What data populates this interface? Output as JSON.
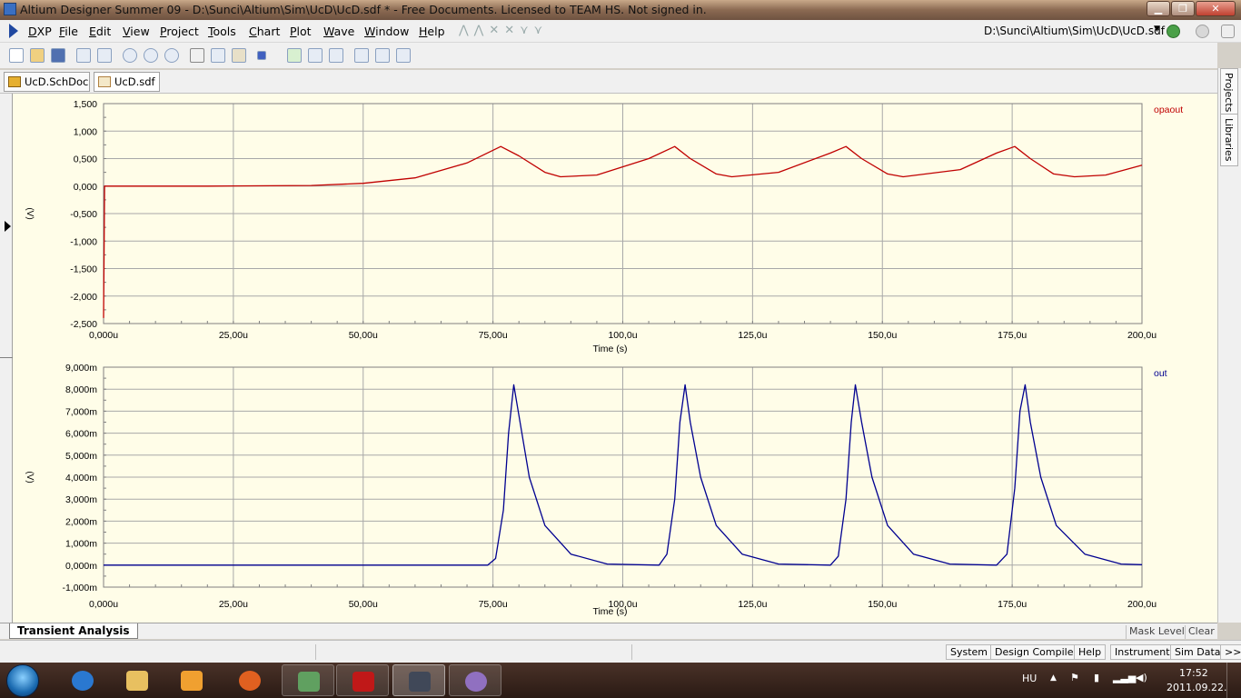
{
  "window": {
    "title": "Altium Designer Summer 09 - D:\\Sunci\\Altium\\Sim\\UcD\\UcD.sdf * - Free Documents. Licensed to TEAM HS. Not signed in."
  },
  "menu": {
    "items": [
      "DXP",
      "File",
      "Edit",
      "View",
      "Project",
      "Tools",
      "Chart",
      "Plot",
      "Wave",
      "Window",
      "Help"
    ],
    "path": "D:\\Sunci\\Altium\\Sim\\UcD\\UcD.sdf"
  },
  "tabs": {
    "documents": [
      "UcD.SchDoc *",
      "UcD.sdf *"
    ]
  },
  "right_panel": {
    "tabs": [
      "Projects",
      "Libraries"
    ]
  },
  "chart_data": [
    {
      "type": "line",
      "series": [
        {
          "name": "opaout",
          "color": "#c00000"
        }
      ],
      "ylabel": "(V)",
      "xlabel": "Time (s)",
      "ylim": [
        -2.5,
        1.5
      ],
      "xlim": [
        0,
        200
      ],
      "yticks": [
        "1,500",
        "1,000",
        "0,500",
        "0,000",
        "-0,500",
        "-1,000",
        "-1,500",
        "-2,000",
        "-2,500"
      ],
      "xticks": [
        "0,000u",
        "25,00u",
        "50,00u",
        "75,00u",
        "100,0u",
        "125,0u",
        "150,0u",
        "175,0u",
        "200,0u"
      ],
      "points": [
        [
          0,
          -2.4
        ],
        [
          0.2,
          0
        ],
        [
          20,
          0
        ],
        [
          40,
          0.01
        ],
        [
          50,
          0.05
        ],
        [
          60,
          0.15
        ],
        [
          70,
          0.42
        ],
        [
          76.5,
          0.72
        ],
        [
          80,
          0.55
        ],
        [
          85,
          0.25
        ],
        [
          88,
          0.17
        ],
        [
          95,
          0.2
        ],
        [
          105,
          0.5
        ],
        [
          110,
          0.72
        ],
        [
          113,
          0.5
        ],
        [
          118,
          0.22
        ],
        [
          121,
          0.17
        ],
        [
          130,
          0.25
        ],
        [
          140,
          0.6
        ],
        [
          143,
          0.72
        ],
        [
          146,
          0.5
        ],
        [
          151,
          0.22
        ],
        [
          154,
          0.17
        ],
        [
          165,
          0.3
        ],
        [
          172,
          0.6
        ],
        [
          175.5,
          0.72
        ],
        [
          178.5,
          0.5
        ],
        [
          183,
          0.22
        ],
        [
          187,
          0.17
        ],
        [
          193,
          0.2
        ],
        [
          200,
          0.38
        ]
      ]
    },
    {
      "type": "line",
      "series": [
        {
          "name": "out",
          "color": "#000090"
        }
      ],
      "ylabel": "(V)",
      "xlabel": "Time (s)",
      "ylim": [
        -1,
        9
      ],
      "xlim": [
        0,
        200
      ],
      "yticks": [
        "9,000m",
        "8,000m",
        "7,000m",
        "6,000m",
        "5,000m",
        "4,000m",
        "3,000m",
        "2,000m",
        "1,000m",
        "0,000m",
        "-1,000m"
      ],
      "xticks": [
        "0,000u",
        "25,00u",
        "50,00u",
        "75,00u",
        "100,0u",
        "125,0u",
        "150,0u",
        "175,0u",
        "200,0u"
      ],
      "points": [
        [
          0,
          0
        ],
        [
          74,
          0
        ],
        [
          75.5,
          0.3
        ],
        [
          77,
          2.5
        ],
        [
          78,
          6
        ],
        [
          79,
          8.2
        ],
        [
          80,
          6.8
        ],
        [
          82,
          4
        ],
        [
          85,
          1.8
        ],
        [
          90,
          0.5
        ],
        [
          97,
          0.05
        ],
        [
          107,
          0
        ],
        [
          108.5,
          0.5
        ],
        [
          110,
          3
        ],
        [
          111,
          6.5
        ],
        [
          112,
          8.2
        ],
        [
          113,
          6.5
        ],
        [
          115,
          4
        ],
        [
          118,
          1.8
        ],
        [
          123,
          0.5
        ],
        [
          130,
          0.05
        ],
        [
          140,
          0
        ],
        [
          141.5,
          0.4
        ],
        [
          143,
          3
        ],
        [
          144,
          6.5
        ],
        [
          144.8,
          8.2
        ],
        [
          146,
          6.5
        ],
        [
          148,
          4
        ],
        [
          151,
          1.8
        ],
        [
          156,
          0.5
        ],
        [
          163,
          0.05
        ],
        [
          172,
          0
        ],
        [
          174,
          0.5
        ],
        [
          175.5,
          3.5
        ],
        [
          176.5,
          7
        ],
        [
          177.5,
          8.2
        ],
        [
          178.5,
          6.5
        ],
        [
          180.5,
          4
        ],
        [
          183.5,
          1.8
        ],
        [
          189,
          0.5
        ],
        [
          196,
          0.05
        ],
        [
          200,
          0.02
        ]
      ]
    }
  ],
  "bottom": {
    "analysis_tab": "Transient Analysis",
    "mask_level": "Mask Level",
    "clear": "Clear"
  },
  "status": {
    "panels": [
      "System",
      "Design Compiler",
      "Help",
      "Instruments",
      "Sim Data"
    ],
    "more": ">>"
  },
  "taskbar": {
    "lang": "HU",
    "time": "17:52",
    "date": "2011.09.22."
  }
}
